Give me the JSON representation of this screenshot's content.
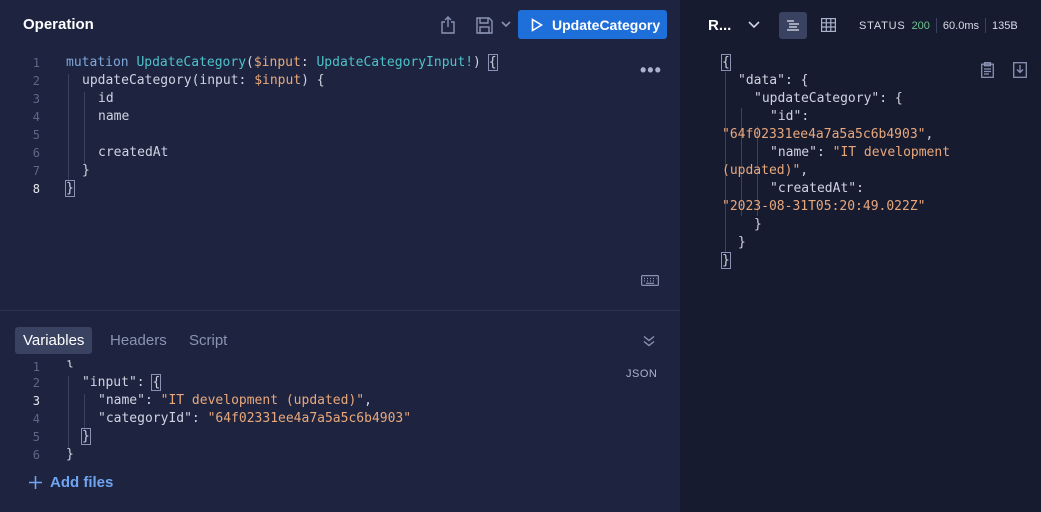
{
  "operation": {
    "title": "Operation",
    "run_label": "UpdateCategory",
    "more_label": "•••"
  },
  "editor": {
    "line_numbers": [
      "1",
      "2",
      "3",
      "4",
      "5",
      "6",
      "7",
      "8"
    ],
    "code": {
      "l1_kw": "mutation",
      "l1_name": "UpdateCategory",
      "l1_open": "(",
      "l1_var": "$input",
      "l1_colon": ": ",
      "l1_type": "UpdateCategoryInput!",
      "l1_close": ") ",
      "l1_brace": "{",
      "l2_field": "updateCategory(input: ",
      "l2_var": "$input",
      "l2_close": ") {",
      "l3": "id",
      "l4": "name",
      "l6": "createdAt",
      "l7": "}",
      "l8": "}"
    }
  },
  "bottom": {
    "tabs": [
      "Variables",
      "Headers",
      "Script"
    ],
    "json_label": "JSON",
    "add_files": "Add files",
    "line_numbers": [
      "1",
      "2",
      "3",
      "4",
      "5",
      "6"
    ],
    "vars": {
      "l1": "{",
      "l2_key": "\"input\"",
      "l2_rest": ": ",
      "l2_brace": "{",
      "l3_key": "\"name\"",
      "l3_sep": ": ",
      "l3_val": "\"IT development (updated)\"",
      "l3_end": ",",
      "l4_key": "\"categoryId\"",
      "l4_sep": ": ",
      "l4_val": "\"64f02331ee4a7a5a5c6b4903\"",
      "l5": "}",
      "l6": "}"
    }
  },
  "response": {
    "title": "R...",
    "status_label": "STATUS",
    "status_code": "200",
    "time": "60.0ms",
    "size": "135B",
    "lines": {
      "l1": "{",
      "l2a": "\"data\"",
      "l2b": ": {",
      "l3a": "\"updateCategory\"",
      "l3b": ": {",
      "l4a": "\"id\"",
      "l4b": ":",
      "l5": "\"64f02331ee4a7a5a5c6b4903\"",
      "l5b": ",",
      "l6a": "\"name\"",
      "l6b": ": ",
      "l6c": "\"IT development",
      "l7": "(updated)\"",
      "l7b": ",",
      "l8a": "\"createdAt\"",
      "l8b": ":",
      "l9": "\"2023-08-31T05:20:49.022Z\"",
      "l10": "}",
      "l11": "}",
      "l12": "}"
    }
  }
}
